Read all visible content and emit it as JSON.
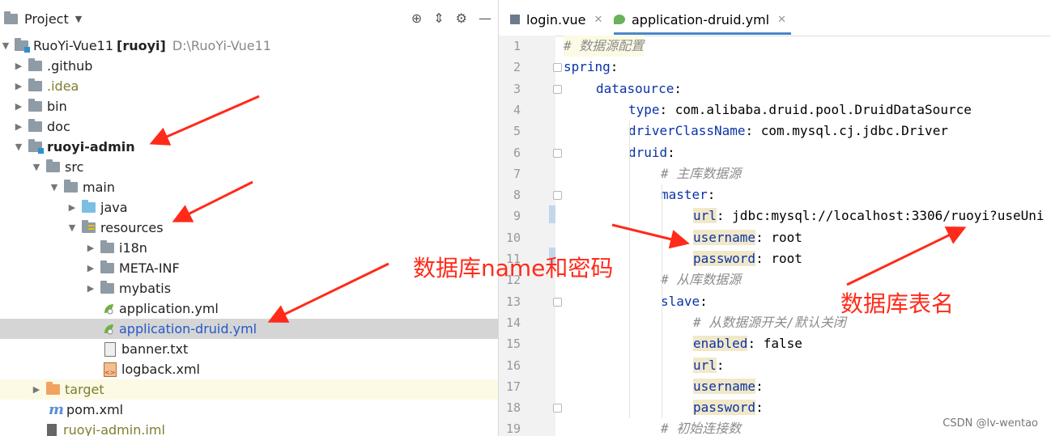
{
  "project_panel": {
    "title": "Project",
    "tree": [
      {
        "label": "RuoYi-Vue11",
        "suffix": "[ruoyi]",
        "path": "D:\\RuoYi-Vue11"
      },
      {
        "label": ".github"
      },
      {
        "label": ".idea"
      },
      {
        "label": "bin"
      },
      {
        "label": "doc"
      },
      {
        "label": "ruoyi-admin"
      },
      {
        "label": "src"
      },
      {
        "label": "main"
      },
      {
        "label": "java"
      },
      {
        "label": "resources"
      },
      {
        "label": "i18n"
      },
      {
        "label": "META-INF"
      },
      {
        "label": "mybatis"
      },
      {
        "label": "application.yml"
      },
      {
        "label": "application-druid.yml"
      },
      {
        "label": "banner.txt"
      },
      {
        "label": "logback.xml"
      },
      {
        "label": "target"
      },
      {
        "label": "pom.xml"
      },
      {
        "label": "ruoyi-admin.iml"
      }
    ]
  },
  "editor": {
    "tabs": [
      {
        "label": "login.vue"
      },
      {
        "label": "application-druid.yml"
      }
    ],
    "lines": [
      {
        "n": "1",
        "comment": "# 数据源配置"
      },
      {
        "n": "2",
        "key": "spring",
        "sep": ":"
      },
      {
        "n": "3",
        "key": "datasource",
        "sep": ":"
      },
      {
        "n": "4",
        "key": "type",
        "sep": ": ",
        "value": "com.alibaba.druid.pool.DruidDataSource"
      },
      {
        "n": "5",
        "key": "driverClassName",
        "sep": ": ",
        "value": "com.mysql.cj.jdbc.Driver"
      },
      {
        "n": "6",
        "key": "druid",
        "sep": ":"
      },
      {
        "n": "7",
        "comment": "# 主库数据源"
      },
      {
        "n": "8",
        "key": "master",
        "sep": ":"
      },
      {
        "n": "9",
        "key": "url",
        "sep": ": ",
        "value": "jdbc:mysql://localhost:3306/ruoyi?useUni"
      },
      {
        "n": "10",
        "key": "username",
        "sep": ": ",
        "value": "root"
      },
      {
        "n": "11",
        "key": "password",
        "sep": ": ",
        "value": "root"
      },
      {
        "n": "12",
        "comment": "# 从库数据源"
      },
      {
        "n": "13",
        "key": "slave",
        "sep": ":"
      },
      {
        "n": "14",
        "comment": "# 从数据源开关/默认关闭"
      },
      {
        "n": "15",
        "key": "enabled",
        "sep": ": ",
        "value": "false"
      },
      {
        "n": "16",
        "key": "url",
        "sep": ":"
      },
      {
        "n": "17",
        "key": "username",
        "sep": ":"
      },
      {
        "n": "18",
        "key": "password",
        "sep": ":"
      },
      {
        "n": "19",
        "comment": "# 初始连接数"
      }
    ]
  },
  "annotations": {
    "name_password": "数据库name和密码",
    "table_name": "数据库表名"
  },
  "watermark": "CSDN @lv-wentao",
  "colors": {
    "annotation_red": "#ff2a1a",
    "key_blue": "#0b33a8",
    "selection": "#d5d5d5",
    "tab_underline": "#4a88c7"
  }
}
